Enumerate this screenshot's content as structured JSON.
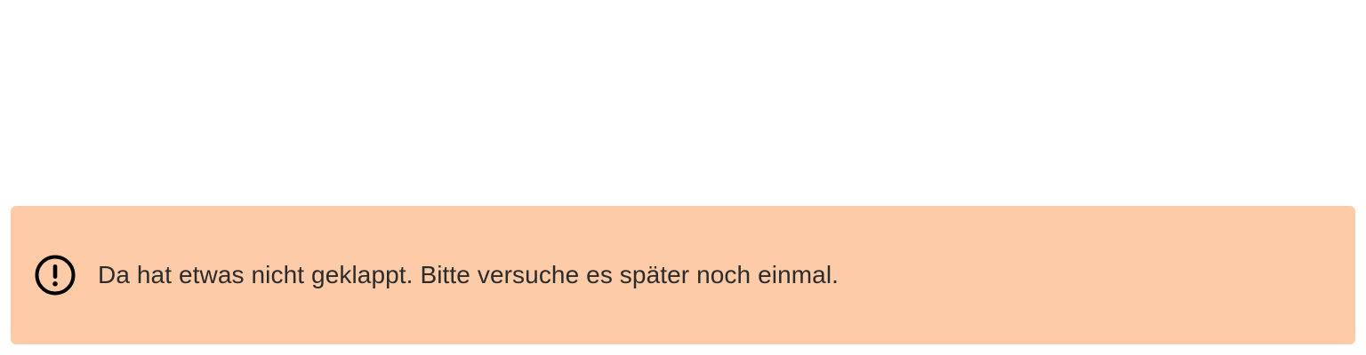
{
  "alert": {
    "icon": "exclamation-circle-icon",
    "message": "Da hat etwas nicht geklappt. Bitte versuche es später noch einmal.",
    "background_color": "#fecba9",
    "text_color": "#2b2b2b",
    "icon_color": "#000000"
  }
}
